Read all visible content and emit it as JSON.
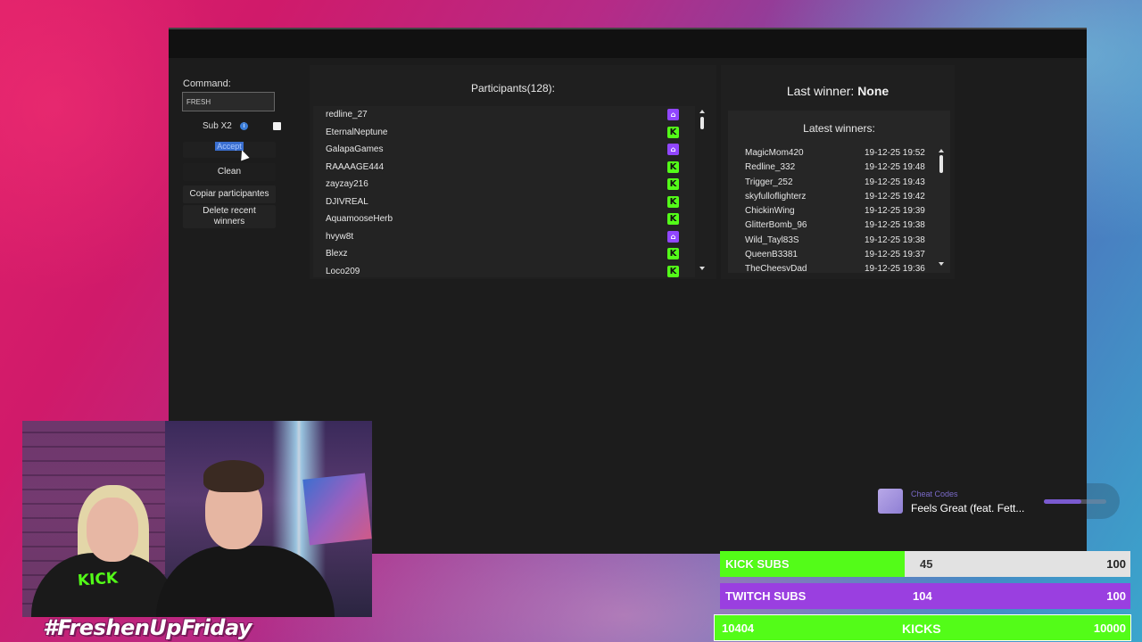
{
  "app": {
    "command_label": "Command:",
    "command_value": "FRESH",
    "sub_label": "Sub X2",
    "info_icon": "i",
    "selected_button_label": "Accept",
    "clean_button": "Clean",
    "copy_button": "Copiar participantes",
    "delete_button_line1": "Delete recent",
    "delete_button_line2": "winners",
    "participants_title": "Participants(128):",
    "participants": [
      {
        "name": "redline_27",
        "platform": "twitch"
      },
      {
        "name": "EternalNeptune",
        "platform": "kick"
      },
      {
        "name": "GalapaGames",
        "platform": "twitch"
      },
      {
        "name": "RAAAAGE444",
        "platform": "kick"
      },
      {
        "name": "zayzay216",
        "platform": "kick"
      },
      {
        "name": "DJIVREAL",
        "platform": "kick"
      },
      {
        "name": "AquamooseHerb",
        "platform": "kick"
      },
      {
        "name": "hvyw8t",
        "platform": "twitch"
      },
      {
        "name": "Blexz",
        "platform": "kick"
      },
      {
        "name": "Loco209",
        "platform": "kick"
      }
    ],
    "last_winner_label": "Last winner:",
    "last_winner_value": "None",
    "latest_winners_title": "Latest winners:",
    "latest_winners": [
      {
        "name": "MagicMom420",
        "date": "19-12-25 19:52"
      },
      {
        "name": "Redline_332",
        "date": "19-12-25 19:48"
      },
      {
        "name": "Trigger_252",
        "date": "19-12-25 19:43"
      },
      {
        "name": "skyfulloflighterz",
        "date": "19-12-25 19:42"
      },
      {
        "name": "ChickinWing",
        "date": "19-12-25 19:39"
      },
      {
        "name": "GlitterBomb_96",
        "date": "19-12-25 19:38"
      },
      {
        "name": "Wild_Tayl83S",
        "date": "19-12-25 19:38"
      },
      {
        "name": "QueenB3381",
        "date": "19-12-25 19:37"
      },
      {
        "name": "TheCheesyDad",
        "date": "19-12-25 19:36"
      }
    ]
  },
  "overlay": {
    "hashtag": "#FreshenUpFriday",
    "shirt_text": "KICK",
    "now_playing": {
      "artist": "Cheat Codes",
      "song": "Feels Great (feat. Fett...",
      "progress": 0.6
    },
    "goals": {
      "kick_subs": {
        "label": "KICK SUBS",
        "current": "45",
        "target": "100",
        "fill": 0.45
      },
      "twitch_subs": {
        "label": "TWITCH SUBS",
        "current": "104",
        "target": "100"
      },
      "kicks": {
        "label": "KICKS",
        "current": "10404",
        "target": "10000"
      }
    }
  },
  "colors": {
    "kick_green": "#53fc18",
    "twitch_purple": "#9146ff",
    "panel_bg": "#1f1f1f"
  },
  "icons": {
    "kick": "K",
    "twitch": "⌂"
  }
}
